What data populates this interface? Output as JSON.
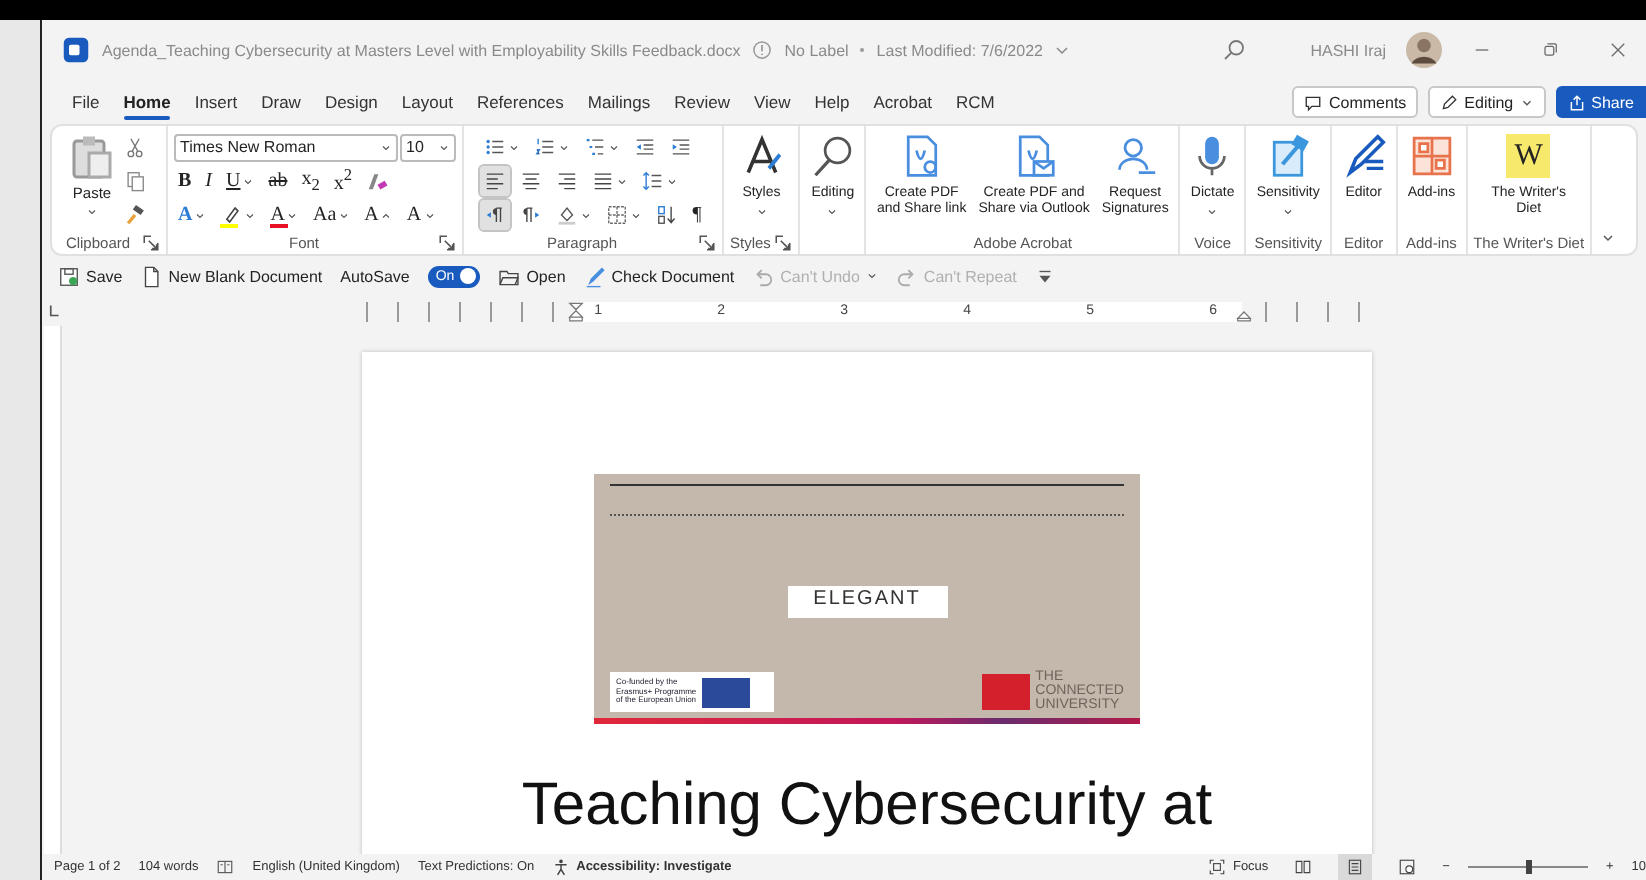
{
  "window": {
    "title": "Agenda_Teaching Cybersecurity at Masters Level with Employability Skills Feedback.docx",
    "label": "No Label",
    "modified": "Last Modified: 7/6/2022",
    "user": "HASHI Iraj"
  },
  "menu_tabs": [
    {
      "label": "File",
      "selected": false
    },
    {
      "label": "Home",
      "selected": true
    },
    {
      "label": "Insert",
      "selected": false
    },
    {
      "label": "Draw",
      "selected": false
    },
    {
      "label": "Design",
      "selected": false
    },
    {
      "label": "Layout",
      "selected": false
    },
    {
      "label": "References",
      "selected": false
    },
    {
      "label": "Mailings",
      "selected": false
    },
    {
      "label": "Review",
      "selected": false
    },
    {
      "label": "View",
      "selected": false
    },
    {
      "label": "Help",
      "selected": false
    },
    {
      "label": "Acrobat",
      "selected": false
    },
    {
      "label": "RCM",
      "selected": false
    }
  ],
  "header_buttons": [
    {
      "kind": "comments",
      "label": "Comments"
    },
    {
      "kind": "editing",
      "label": "Editing"
    },
    {
      "kind": "share",
      "label": "Share"
    }
  ],
  "ribbon": {
    "groups": [
      {
        "kind": "clipboard",
        "label": "Clipboard",
        "launcher": true,
        "paste": "Paste"
      },
      {
        "kind": "font",
        "label": "Font",
        "launcher": true,
        "font_name": "Times New Roman",
        "font_size": "10",
        "rows": [
          {
            "buttons": [
              {
                "kind": "bold",
                "glyph": "B",
                "selected": false
              },
              {
                "kind": "italic",
                "glyph": "I",
                "selected": false
              },
              {
                "kind": "underline",
                "glyph": "U",
                "dropdown": true,
                "selected": false
              },
              {
                "kind": "strike",
                "glyph": "ab",
                "selected": false
              },
              {
                "kind": "subscript",
                "glyph": "x$_{2}$",
                "selected": false
              },
              {
                "kind": "superscript",
                "glyph": "x$^{2}$",
                "selected": false
              },
              {
                "kind": "clear",
                "selected": false
              }
            ]
          },
          {
            "buttons": [
              {
                "kind": "effects",
                "glyph": "A",
                "dropdown": true,
                "selected": false
              },
              {
                "kind": "highlight",
                "dropdown": true,
                "color": "#ffff00",
                "selected": false
              },
              {
                "kind": "fontcolor",
                "glyph": "A",
                "dropdown": true,
                "color": "#e81123",
                "selected": false
              },
              {
                "kind": "case",
                "glyph": "Aa",
                "dropdown": true,
                "selected": false
              },
              {
                "kind": "grow",
                "glyph": "A",
                "selected": false
              },
              {
                "kind": "shrink",
                "glyph": "A",
                "selected": false
              }
            ]
          }
        ]
      },
      {
        "kind": "paragraph",
        "label": "Paragraph",
        "launcher": true,
        "rows": [
          {
            "buttons": [
              {
                "kind": "bullets",
                "dropdown": true,
                "selected": false
              },
              {
                "kind": "numbering",
                "dropdown": true,
                "selected": false
              },
              {
                "kind": "multilevel",
                "dropdown": true,
                "selected": false
              },
              {
                "kind": "outdent",
                "selected": false
              },
              {
                "kind": "indent",
                "selected": false
              }
            ]
          },
          {
            "buttons": [
              {
                "kind": "left",
                "selected": true
              },
              {
                "kind": "center",
                "selected": false
              },
              {
                "kind": "right",
                "selected": false
              },
              {
                "kind": "justify",
                "dropdown": true,
                "selected": false
              },
              {
                "kind": "spacing",
                "dropdown": true,
                "selected": false
              }
            ]
          },
          {
            "buttons": [
              {
                "kind": "ltr",
                "selected": true
              },
              {
                "kind": "rtl",
                "selected": false
              },
              {
                "kind": "shading",
                "dropdown": true,
                "selected": false
              },
              {
                "kind": "borders",
                "dropdown": true,
                "selected": false
              },
              {
                "kind": "sort",
                "selected": false
              },
              {
                "kind": "marks",
                "glyph": "¶",
                "selected": false
              }
            ]
          }
        ]
      },
      {
        "kind": "large",
        "label": "Styles",
        "launcher": true,
        "buttons": [
          {
            "kind": "styles",
            "label": "Styles",
            "dropdown": true
          }
        ]
      },
      {
        "kind": "large",
        "buttons": [
          {
            "kind": "find",
            "label": "Editing",
            "dropdown": true
          }
        ]
      },
      {
        "kind": "large",
        "label": "Adobe Acrobat",
        "buttons": [
          {
            "kind": "pdflink",
            "label": "Create PDF\nand Share link"
          },
          {
            "kind": "pdfmail",
            "label": "Create PDF and\nShare via Outlook"
          },
          {
            "kind": "sign",
            "label": "Request\nSignatures"
          }
        ]
      },
      {
        "kind": "large",
        "label": "Voice",
        "buttons": [
          {
            "kind": "mic",
            "label": "Dictate",
            "dropdown": true
          }
        ]
      },
      {
        "kind": "large",
        "label": "Sensitivity",
        "buttons": [
          {
            "kind": "tag",
            "label": "Sensitivity",
            "dropdown": true
          }
        ]
      },
      {
        "kind": "large",
        "label": "Editor",
        "buttons": [
          {
            "kind": "editor",
            "label": "Editor"
          }
        ]
      },
      {
        "kind": "large",
        "label": "Add-ins",
        "buttons": [
          {
            "kind": "addins",
            "label": "Add-ins"
          }
        ]
      },
      {
        "kind": "large",
        "label": "The Writer's Diet",
        "buttons": [
          {
            "kind": "writer",
            "glyph": "W",
            "label": "The Writer's\nDiet"
          }
        ]
      }
    ]
  },
  "quick_toolbar": [
    {
      "kind": "save",
      "label": "Save"
    },
    {
      "kind": "new",
      "label": "New Blank Document"
    },
    {
      "kind": "autosave",
      "label": "AutoSave",
      "toggle": "On",
      "on": true
    },
    {
      "kind": "open",
      "label": "Open"
    },
    {
      "kind": "check",
      "label": "Check Document"
    },
    {
      "kind": "undo",
      "label": "Can't Undo",
      "disabled": true
    },
    {
      "kind": "redo",
      "label": "Can't Repeat",
      "disabled": true
    },
    {
      "kind": "more"
    }
  ],
  "ruler": {
    "numbers": [
      "1",
      "2",
      "3",
      "4",
      "5",
      "6"
    ]
  },
  "document": {
    "banner": {
      "project": "ELEGANT",
      "funding": "Co-funded by the\nErasmus+ Programme\nof the European Union",
      "university": "THE\nCONNECTED\nUNIVERSITY"
    },
    "title": "Teaching Cybersecurity at"
  },
  "status_bar": {
    "page": "Page 1 of 2",
    "words": "104 words",
    "language": "English (United Kingdom)",
    "predictions": "Text Predictions: On",
    "accessibility": "Accessibility: Investigate",
    "focus": "Focus",
    "views": [
      {
        "kind": "read",
        "selected": false
      },
      {
        "kind": "print",
        "selected": true
      },
      {
        "kind": "web",
        "selected": false
      }
    ],
    "zoom_out": "−",
    "zoom": {
      "level": 0.5
    },
    "zoom_in": "+",
    "zoom_value": "10"
  }
}
